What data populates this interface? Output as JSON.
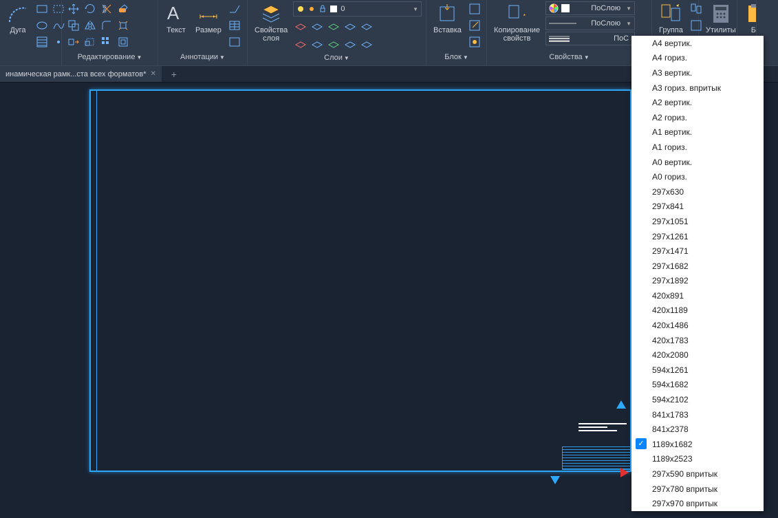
{
  "ribbon": {
    "arc_label": "Дуга",
    "draw_panel_title": "",
    "edit_panel_title": "Редактирование",
    "text_label": "Текст",
    "dim_label": "Размер",
    "annot_panel_title": "Аннотации",
    "layerprops_label": "Свойства\nслоя",
    "layer_combo_value": "0",
    "layers_panel_title": "Слои",
    "insert_label": "Вставка",
    "block_panel_title": "Блок",
    "matchprops_label": "Копирование\nсвойств",
    "prop_color_value": "ПоСлою",
    "prop_line_value": "ПоСлою",
    "prop_lwt_value": "ПоС",
    "props_panel_title": "Свойства",
    "group_label": "Группа",
    "util_label": "Утилиты",
    "buf_label": "Бу"
  },
  "tabs": {
    "active": "инамическая рамк...ста всех форматов*"
  },
  "dropdown": {
    "items": [
      {
        "label": "A4 вертик.",
        "checked": false
      },
      {
        "label": "A4 гориз.",
        "checked": false
      },
      {
        "label": "A3 вертик.",
        "checked": false
      },
      {
        "label": "A3 гориз. впритык",
        "checked": false
      },
      {
        "label": "A2 вертик.",
        "checked": false
      },
      {
        "label": "A2 гориз.",
        "checked": false
      },
      {
        "label": "A1 вертик.",
        "checked": false
      },
      {
        "label": "A1 гориз.",
        "checked": false
      },
      {
        "label": "A0 вертик.",
        "checked": false
      },
      {
        "label": "A0 гориз.",
        "checked": false
      },
      {
        "label": "297x630",
        "checked": false
      },
      {
        "label": "297x841",
        "checked": false
      },
      {
        "label": "297x1051",
        "checked": false
      },
      {
        "label": "297x1261",
        "checked": false
      },
      {
        "label": "297x1471",
        "checked": false
      },
      {
        "label": "297x1682",
        "checked": false
      },
      {
        "label": "297x1892",
        "checked": false
      },
      {
        "label": "420x891",
        "checked": false
      },
      {
        "label": "420x1189",
        "checked": false
      },
      {
        "label": "420x1486",
        "checked": false
      },
      {
        "label": "420x1783",
        "checked": false
      },
      {
        "label": "420x2080",
        "checked": false
      },
      {
        "label": "594x1261",
        "checked": false
      },
      {
        "label": "594x1682",
        "checked": false
      },
      {
        "label": "594x2102",
        "checked": false
      },
      {
        "label": "841x1783",
        "checked": false
      },
      {
        "label": "841x2378",
        "checked": false
      },
      {
        "label": "1189x1682",
        "checked": true
      },
      {
        "label": "1189x2523",
        "checked": false
      },
      {
        "label": "297x590 впритык",
        "checked": false
      },
      {
        "label": "297x780 впритык",
        "checked": false
      },
      {
        "label": "297x970 впритык",
        "checked": false
      }
    ]
  }
}
